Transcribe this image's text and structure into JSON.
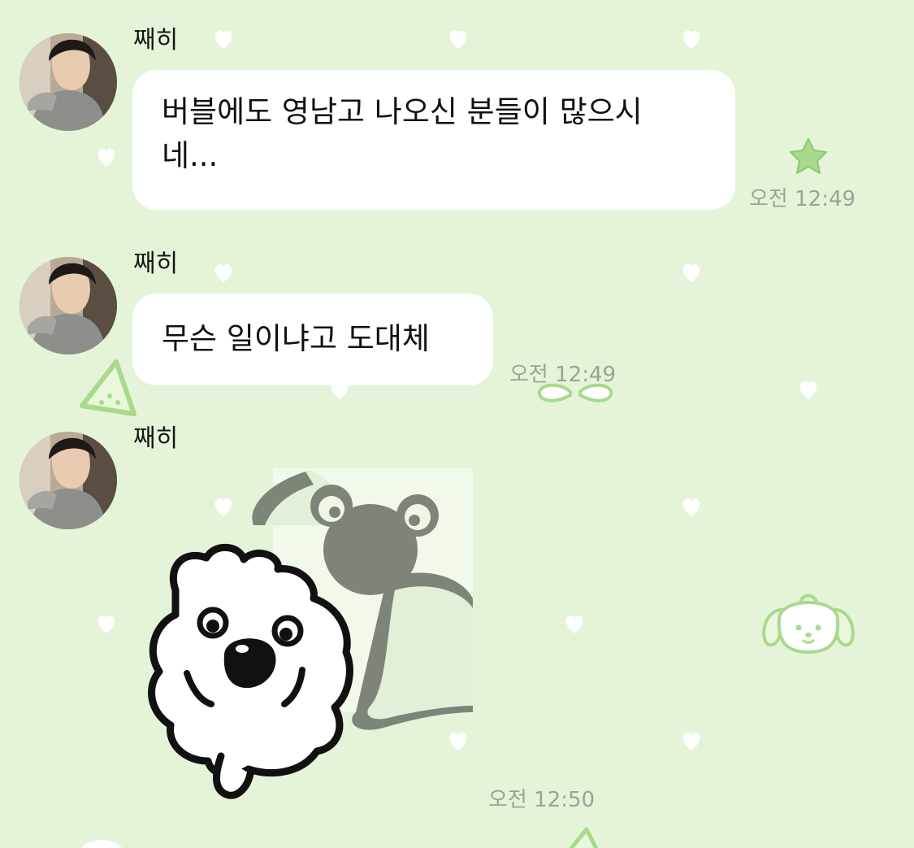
{
  "colors": {
    "background": "#e5f4d8",
    "bubble": "#ffffff",
    "decoration": "#a9d98d",
    "timestamp": "#9aa29a"
  },
  "messages": [
    {
      "sender": "째히",
      "type": "text",
      "text": "버블에도 영남고 나오신 분들이 많으시네...",
      "line1": "버블에도 영남고 나오신 분들이 많으시",
      "line2": "네...",
      "time": "오전 12:49"
    },
    {
      "sender": "째히",
      "type": "text",
      "text": "무슨 일이냐고 도대체",
      "time": "오전 12:49"
    },
    {
      "sender": "째히",
      "type": "sticker",
      "sticker_icon": "white-puppy-sticker",
      "time": "오전 12:50"
    }
  ],
  "background_icons": [
    "heart-icon",
    "star-icon",
    "watermelon-icon",
    "wings-icon",
    "puppy-face-icon"
  ]
}
